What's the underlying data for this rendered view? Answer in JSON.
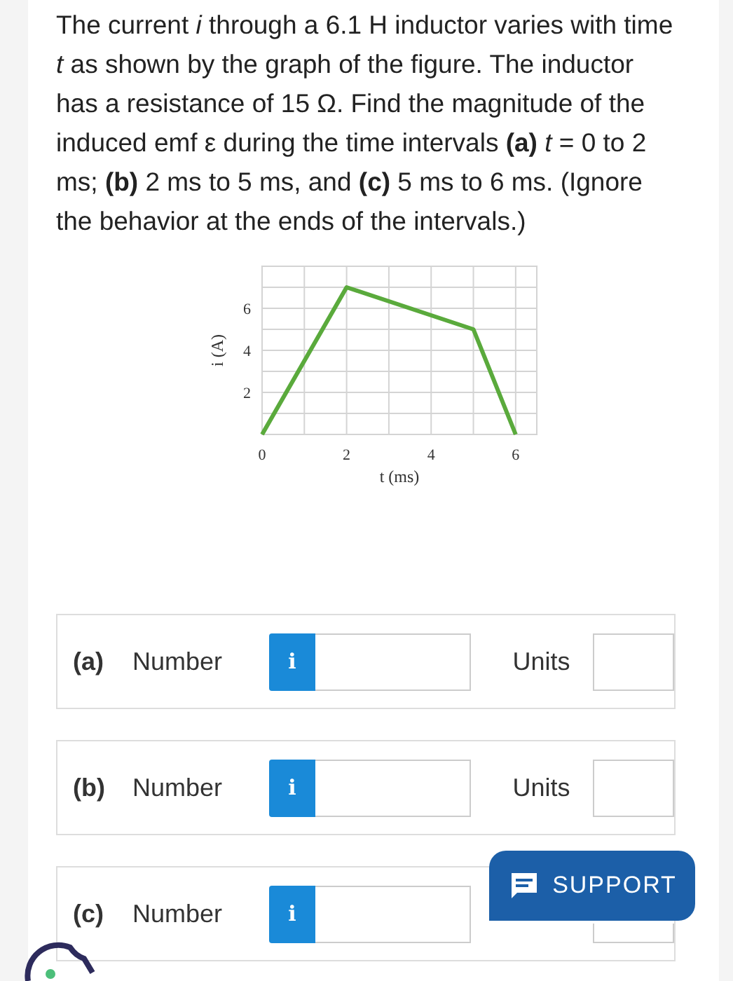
{
  "question": "The current *i* through a 6.1 H inductor varies with time *t* as shown by the graph of the figure. The inductor has a resistance of 15 Ω. Find the magnitude of the induced emf ε during the time intervals **(a)** *t* = 0 to 2 ms; **(b)** 2 ms to 5 ms, and **(c)** 5 ms to 6 ms. (Ignore the behavior at the ends of the intervals.)",
  "figure": {
    "chart_data": {
      "type": "line",
      "xlabel": "t (ms)",
      "ylabel": "i (A)",
      "x": [
        0,
        2,
        5,
        6
      ],
      "series": [
        {
          "color": "#5aaa3c",
          "values": [
            0,
            7,
            5,
            0
          ]
        }
      ],
      "grid": true,
      "xlim": [
        0,
        6.5
      ],
      "ylim": [
        0,
        8
      ],
      "xticks": [
        0,
        2,
        4,
        6
      ],
      "yticks": [
        2,
        4,
        6
      ]
    }
  },
  "answers": [
    {
      "part": "(a)",
      "label": "Number",
      "info": "i",
      "units_label": "Units"
    },
    {
      "part": "(b)",
      "label": "Number",
      "info": "i",
      "units_label": "Units"
    },
    {
      "part": "(c)",
      "label": "Number",
      "info": "i"
    }
  ],
  "support_button": "SUPPORT"
}
